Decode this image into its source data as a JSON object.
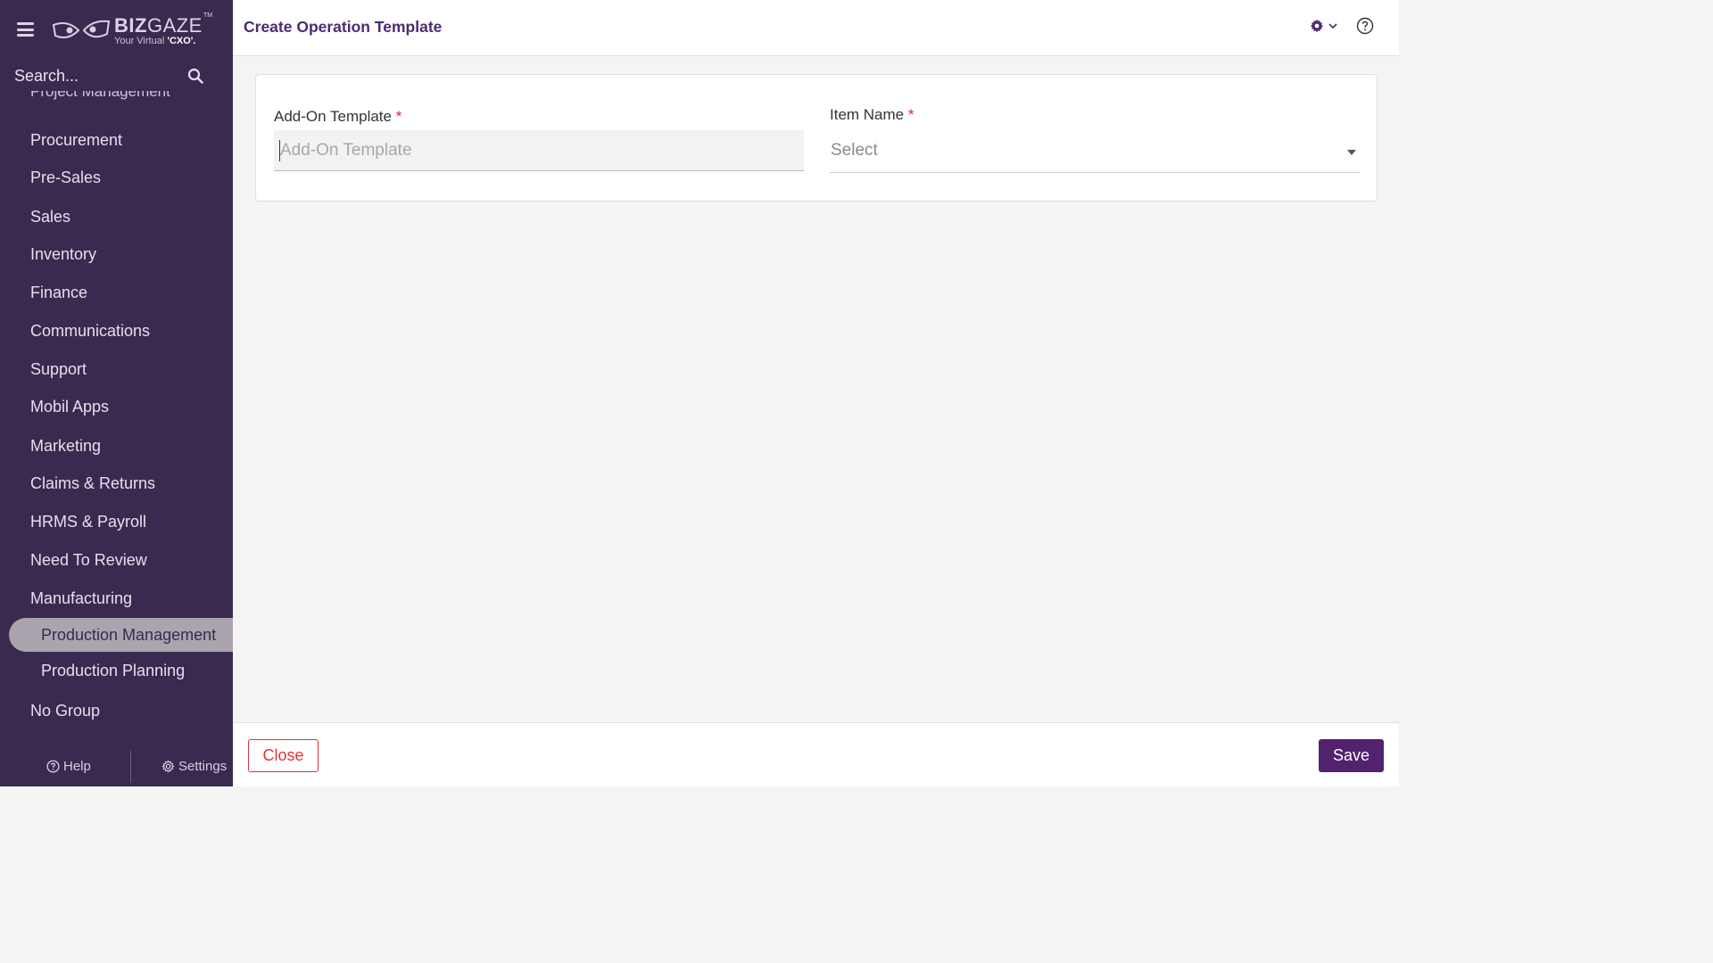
{
  "sidebar": {
    "logo": {
      "brand_bold": "BIZ",
      "brand_light": "GAZE",
      "trademark": "TM",
      "tagline_prefix": "Your Virtual ",
      "tagline_bold": "'CXO'."
    },
    "search": {
      "placeholder": "Search..."
    },
    "partial_item": "Project Management",
    "items": [
      {
        "label": "Procurement"
      },
      {
        "label": "Pre-Sales"
      },
      {
        "label": "Sales"
      },
      {
        "label": "Inventory"
      },
      {
        "label": "Finance"
      },
      {
        "label": "Communications"
      },
      {
        "label": "Support"
      },
      {
        "label": "Mobil Apps"
      },
      {
        "label": "Marketing"
      },
      {
        "label": "Claims & Returns"
      },
      {
        "label": "HRMS & Payroll"
      },
      {
        "label": "Need To Review"
      },
      {
        "label": "Manufacturing"
      }
    ],
    "sub_items": [
      {
        "label": "Production Management",
        "active": true
      },
      {
        "label": "Production Planning",
        "active": false
      }
    ],
    "last_item": "No Group",
    "footer": {
      "help_label": "Help",
      "settings_label": "Settings"
    }
  },
  "header": {
    "title": "Create Operation Template"
  },
  "form": {
    "addon_template": {
      "label": "Add-On Template",
      "required_mark": "*",
      "placeholder": "Add-On Template",
      "value": ""
    },
    "item_name": {
      "label": "Item Name",
      "required_mark": "*",
      "selected": "Select"
    }
  },
  "footer": {
    "close_label": "Close",
    "save_label": "Save"
  },
  "colors": {
    "sidebar_bg": "#3b2a4f",
    "accent": "#52226f",
    "title": "#4d2a72",
    "danger": "#e13434"
  }
}
